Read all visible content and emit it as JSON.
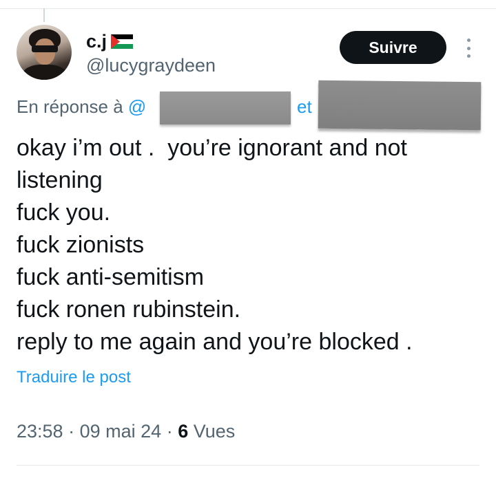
{
  "author": {
    "display_name": "c.j",
    "flag": "palestine-flag",
    "handle": "@lucygraydeen"
  },
  "follow_label": "Suivre",
  "reply_context": {
    "prefix": "En réponse à",
    "mention_start": "@",
    "conjunction": "et"
  },
  "post": {
    "lines": [
      "okay i’m out .  you’re ignorant and not",
      "listening",
      "fuck you.",
      "fuck zionists",
      "fuck anti-semitism",
      "fuck ronen rubinstein.",
      "reply to me again and you’re blocked ."
    ]
  },
  "translate_label": "Traduire le post",
  "meta": {
    "time": "23:58",
    "separator": "·",
    "date": "09 mai 24",
    "views_count": "6",
    "views_label": "Vues"
  },
  "colors": {
    "link": "#1d9bf0",
    "secondary_text": "#536471",
    "primary_text": "#0f1419",
    "follow_button_bg": "#0f1419"
  }
}
